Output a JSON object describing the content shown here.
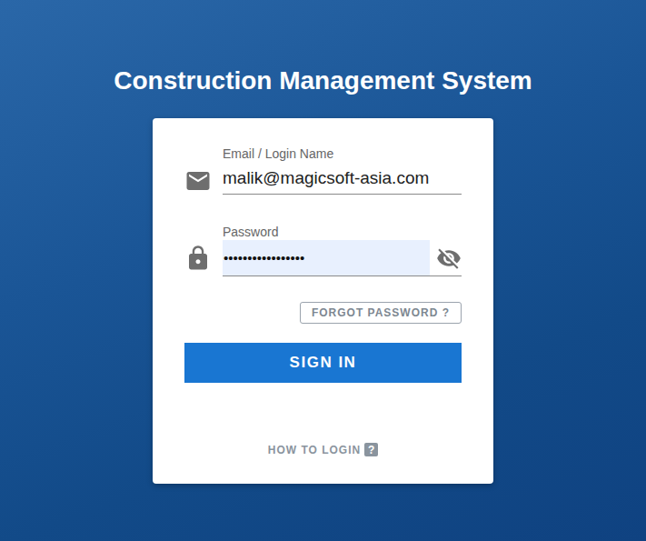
{
  "title": "Construction Management System",
  "email": {
    "label": "Email / Login Name",
    "value": "malik@magicsoft-asia.com"
  },
  "password": {
    "label": "Password",
    "masked_value": "•••••••••••••••••",
    "visible": false
  },
  "forgot_password": "FORGOT PASSWORD ?",
  "sign_in": "SIGN IN",
  "help": {
    "label": "HOW TO LOGIN",
    "icon": "?"
  }
}
